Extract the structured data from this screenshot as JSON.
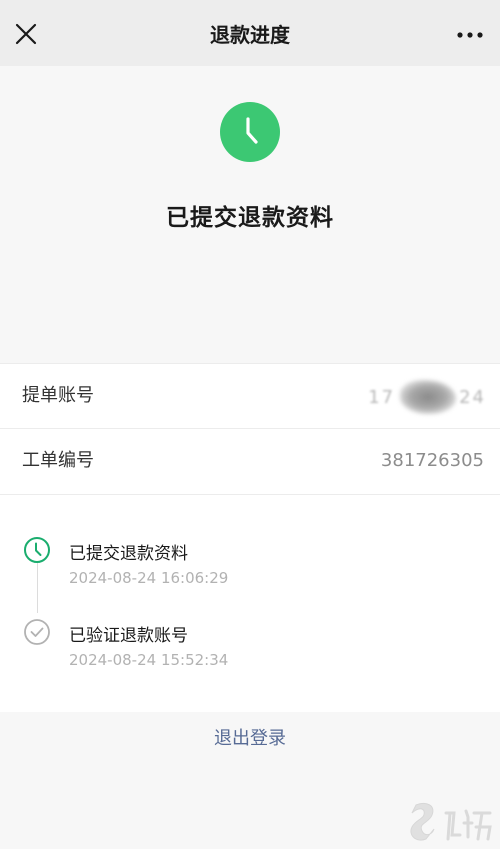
{
  "navbar": {
    "title": "退款进度"
  },
  "status": {
    "title": "已提交退款资料",
    "icon": "clock-icon",
    "color": "#3cc873"
  },
  "info": {
    "rows": [
      {
        "label": "提单账号",
        "value": "17",
        "value_tail": "24"
      },
      {
        "label": "工单编号",
        "value": "381726305"
      }
    ]
  },
  "timeline": [
    {
      "title": "已提交退款资料",
      "time": "2024-08-24 16:06:29",
      "icon": "clock-icon",
      "color": "#1aad6e"
    },
    {
      "title": "已验证退款账号",
      "time": "2024-08-24 15:52:34",
      "icon": "check-circle-icon",
      "color": "#b2b2b2"
    }
  ],
  "footer": {
    "logout_label": "退出登录",
    "link_color": "#576b95"
  }
}
